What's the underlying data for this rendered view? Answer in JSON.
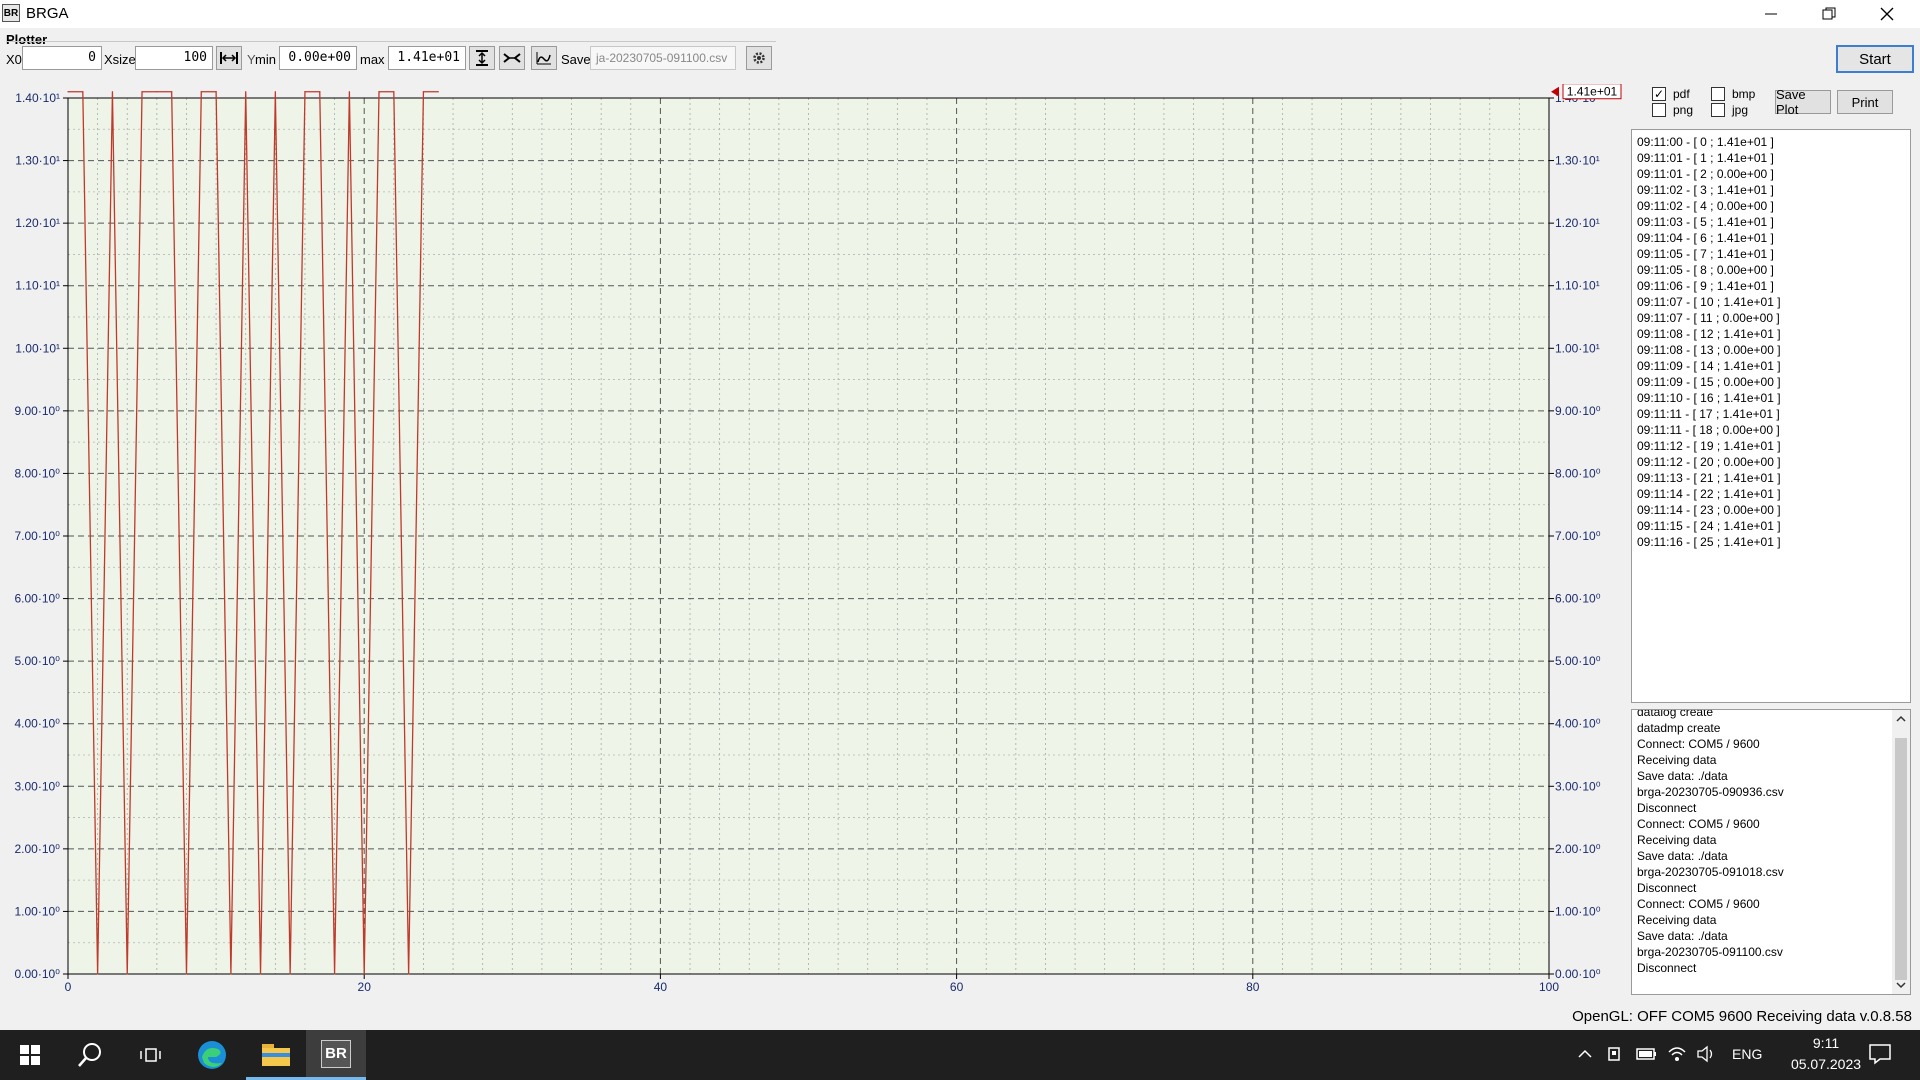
{
  "window": {
    "title": "BRGA",
    "app_icon": "BR",
    "minimize_icon": "minimize-icon",
    "maximize_icon": "restore-icon",
    "close_icon": "close-icon"
  },
  "toolbar": {
    "section_label": "Plotter",
    "x0_label": "X0",
    "x0_value": "0",
    "xsize_label": "Xsize",
    "xsize_value": "100",
    "y_label": "Y",
    "min_label": "min",
    "min_value": "0.00e+00",
    "max_label": "max",
    "max_value": "1.41e+01",
    "save_label": "Save",
    "save_file": "ja-20230705-091100.csv",
    "start_label": "Start"
  },
  "right_panel": {
    "formats": [
      {
        "label": "pdf",
        "checked": true
      },
      {
        "label": "bmp",
        "checked": false
      },
      {
        "label": "png",
        "checked": false
      },
      {
        "label": "jpg",
        "checked": false
      }
    ],
    "save_plot_label": "Save Plot",
    "print_label": "Print",
    "data_entries": [
      "09:11:00 - [ 0 ; 1.41e+01 ]",
      "09:11:01 - [ 1 ; 1.41e+01 ]",
      "09:11:01 - [ 2 ; 0.00e+00 ]",
      "09:11:02 - [ 3 ; 1.41e+01 ]",
      "09:11:02 - [ 4 ; 0.00e+00 ]",
      "09:11:03 - [ 5 ; 1.41e+01 ]",
      "09:11:04 - [ 6 ; 1.41e+01 ]",
      "09:11:05 - [ 7 ; 1.41e+01 ]",
      "09:11:05 - [ 8 ; 0.00e+00 ]",
      "09:11:06 - [ 9 ; 1.41e+01 ]",
      "09:11:07 - [ 10 ; 1.41e+01 ]",
      "09:11:07 - [ 11 ; 0.00e+00 ]",
      "09:11:08 - [ 12 ; 1.41e+01 ]",
      "09:11:08 - [ 13 ; 0.00e+00 ]",
      "09:11:09 - [ 14 ; 1.41e+01 ]",
      "09:11:09 - [ 15 ; 0.00e+00 ]",
      "09:11:10 - [ 16 ; 1.41e+01 ]",
      "09:11:11 - [ 17 ; 1.41e+01 ]",
      "09:11:11 - [ 18 ; 0.00e+00 ]",
      "09:11:12 - [ 19 ; 1.41e+01 ]",
      "09:11:12 - [ 20 ; 0.00e+00 ]",
      "09:11:13 - [ 21 ; 1.41e+01 ]",
      "09:11:14 - [ 22 ; 1.41e+01 ]",
      "09:11:14 - [ 23 ; 0.00e+00 ]",
      "09:11:15 - [ 24 ; 1.41e+01 ]",
      "09:11:16 - [ 25 ; 1.41e+01 ]"
    ],
    "log_entries": [
      "datalog create",
      "datadmp create",
      "Connect: COM5 / 9600",
      "Receiving data",
      "Save data: ./data",
      "brga-20230705-090936.csv",
      "Disconnect",
      "Connect: COM5 / 9600",
      "Receiving data",
      "Save data: ./data",
      "brga-20230705-091018.csv",
      "Disconnect",
      "Connect: COM5 / 9600",
      "Receiving data",
      "Save data: ./data",
      "brga-20230705-091100.csv",
      "Disconnect"
    ]
  },
  "status_bar": "OpenGL: OFF COM5 9600 Receiving data v.0.8.58",
  "taskbar": {
    "language": "ENG",
    "time": "9:11",
    "date": "05.07.2023",
    "app_label": "BR"
  },
  "chart_data": {
    "type": "line",
    "x_range": [
      0,
      100
    ],
    "y_range": [
      0,
      14.0
    ],
    "x_ticks": [
      "0",
      "20",
      "40",
      "60",
      "80",
      "100"
    ],
    "y_ticks": [
      "0.00·10⁰",
      "1.00·10⁰",
      "2.00·10⁰",
      "3.00·10⁰",
      "4.00·10⁰",
      "5.00·10⁰",
      "6.00·10⁰",
      "7.00·10⁰",
      "8.00·10⁰",
      "9.00·10⁰",
      "1.00·10¹",
      "1.10·10¹",
      "1.20·10¹",
      "1.30·10¹",
      "1.40·10¹"
    ],
    "y_tick_values": [
      0,
      1,
      2,
      3,
      4,
      5,
      6,
      7,
      8,
      9,
      10,
      11,
      12,
      13,
      14
    ],
    "marker_label": "1.41e+01",
    "series": [
      {
        "color": "#c0392b",
        "x": [
          0,
          1,
          2,
          3,
          4,
          5,
          6,
          7,
          8,
          9,
          10,
          11,
          12,
          13,
          14,
          15,
          16,
          17,
          18,
          19,
          20,
          21,
          22,
          23,
          24,
          25
        ],
        "values": [
          14.1,
          14.1,
          0,
          14.1,
          0,
          14.1,
          14.1,
          14.1,
          0,
          14.1,
          14.1,
          0,
          14.1,
          0,
          14.1,
          0,
          14.1,
          14.1,
          0,
          14.1,
          0,
          14.1,
          14.1,
          0,
          14.1,
          14.1
        ]
      }
    ],
    "grid": true,
    "background": "#eef5e8"
  }
}
